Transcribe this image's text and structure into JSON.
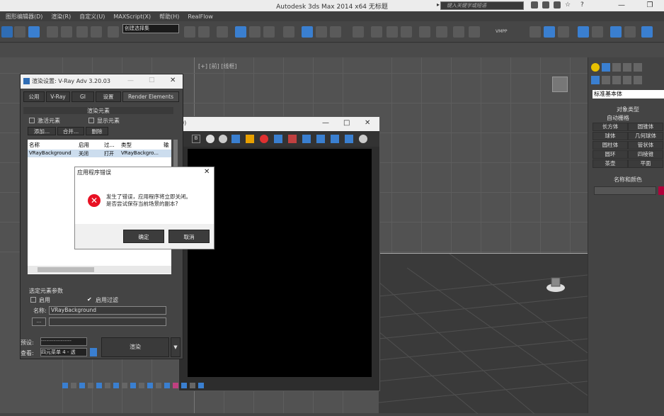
{
  "app": {
    "title": "Autodesk 3ds Max  2014 x64    无标题",
    "search_placeholder": "键入关键字或短语"
  },
  "menubar": [
    "图形编辑器(D)",
    "渲染(R)",
    "自定义(U)",
    "MAXScript(X)",
    "帮助(H)",
    "RealFlow"
  ],
  "toolbar": {
    "selection_filter": "创建选择集",
    "vmpp": "VMPP"
  },
  "viewport": {
    "label": "[+] [前] [线框]"
  },
  "command_panel": {
    "dropdown": "标准基本体",
    "object_type": "对象类型",
    "autogrid": "自动栅格",
    "buttons": [
      "长方体",
      "圆锥体",
      "球体",
      "几何球体",
      "圆柱体",
      "管状体",
      "圆环",
      "四棱锥",
      "茶壶",
      "平面"
    ],
    "name_color": "名称和颜色"
  },
  "frame_window": {
    "title_fragment": "0)",
    "minimize": "—",
    "maximize": "□",
    "close": "✕"
  },
  "render_dialog": {
    "title": "渲染设置: V-Ray Adv 3.20.03",
    "tabs": [
      "公用",
      "V-Ray",
      "GI",
      "设置",
      "Render Elements"
    ],
    "section": "渲染元素",
    "activate_label": "激活元素",
    "display_label": "显示元素",
    "btn_add": "添加...",
    "btn_merge": "合并...",
    "btn_delete": "删除",
    "list_headers": [
      "名称",
      "启用",
      "过...",
      "类型",
      "输"
    ],
    "list_row": [
      "VRayBackground",
      "关闭",
      "打开",
      "VRayBackgro..."
    ],
    "selected_params": "选定元素参数",
    "enable": "启用",
    "enable_filter": "启用过滤",
    "name_label": "名称:",
    "name_value": "VRayBackground",
    "btn_browse": "...",
    "preset_label": "预设:",
    "preset_value": "-----------------",
    "view_label": "查看:",
    "view_value": "四元菜单 4 - 透",
    "render_btn": "渲染"
  },
  "error_dialog": {
    "title": "应用程序错误",
    "line1": "发生了错误，应用程序将立即关闭。",
    "line2": "是否尝试保存当前场景的副本?",
    "ok": "确定",
    "cancel": "取消",
    "close": "✕"
  }
}
